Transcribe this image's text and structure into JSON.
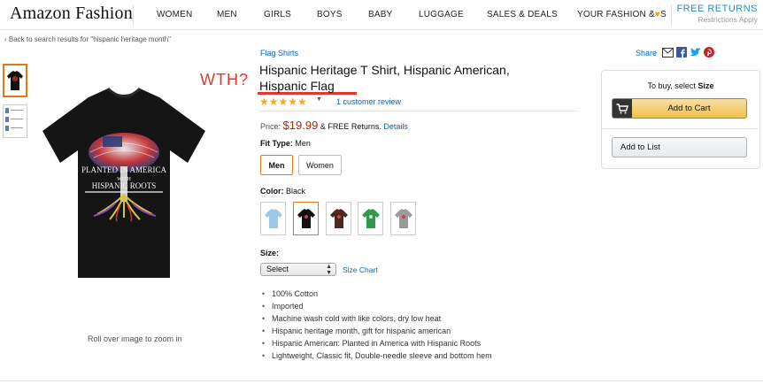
{
  "nav": {
    "logo": "Amazon Fashion",
    "items": [
      "WOMEN",
      "MEN",
      "GIRLS",
      "BOYS",
      "BABY",
      "LUGGAGE",
      "SALES & DEALS"
    ],
    "your_fashion_pre": "YOUR FASHION &",
    "your_fashion_post": "S",
    "free_returns": "FREE RETURNS",
    "restrictions": "Restrictions Apply"
  },
  "breadcrumb": "‹ Back to search results for \"hispanic heritage month\"",
  "annotation": {
    "text": "WTH?",
    "color": "#e0382e"
  },
  "product": {
    "brand": "Flag Shirts",
    "title_line1": "Hispanic Heritage T Shirt, Hispanic American,",
    "title_line2": "Hispanic Flag",
    "rating_stars": 5,
    "review_link": "1 customer review",
    "price_label": "Price:",
    "price": "$19.99",
    "price_suffix": "& FREE Returns.",
    "details_link": "Details",
    "fit_label": "Fit Type:",
    "fit_value": "Men",
    "fit_options": [
      "Men",
      "Women"
    ],
    "color_label": "Color:",
    "color_value": "Black",
    "swatches": [
      {
        "name": "light-blue",
        "color": "#9ec8e6"
      },
      {
        "name": "black",
        "color": "#111111"
      },
      {
        "name": "brown",
        "color": "#4a2a1c"
      },
      {
        "name": "green",
        "color": "#2e9a4a"
      },
      {
        "name": "heather-grey",
        "color": "#9b9b9b"
      }
    ],
    "size_label": "Size:",
    "size_select": "Select",
    "size_chart": "Size Chart",
    "bullets": [
      "100% Cotton",
      "Imported",
      "Machine wash cold with like colors, dry low heat",
      "Hispanic heritage month, gift for hispanic american",
      "Hispanic American: Planted in America with Hispanic Roots",
      "Lightweight, Classic fit, Double-needle sleeve and bottom hem"
    ],
    "zoom_hint": "Roll over image to zoom in",
    "shirt_text": {
      "line1": "PLANTED IN AMERICA",
      "line2": "WITH",
      "line3": "HISPANIC ROOTS"
    }
  },
  "buybox": {
    "share": "Share",
    "to_buy_pre": "To buy, select",
    "to_buy_bold": "Size",
    "add_to_cart": "Add to Cart",
    "add_to_list": "Add to List"
  },
  "colors": {
    "accent_orange": "#e47911",
    "link_blue": "#0066c0",
    "price_red": "#b12704",
    "cart_yellow": "#f0c14b"
  }
}
